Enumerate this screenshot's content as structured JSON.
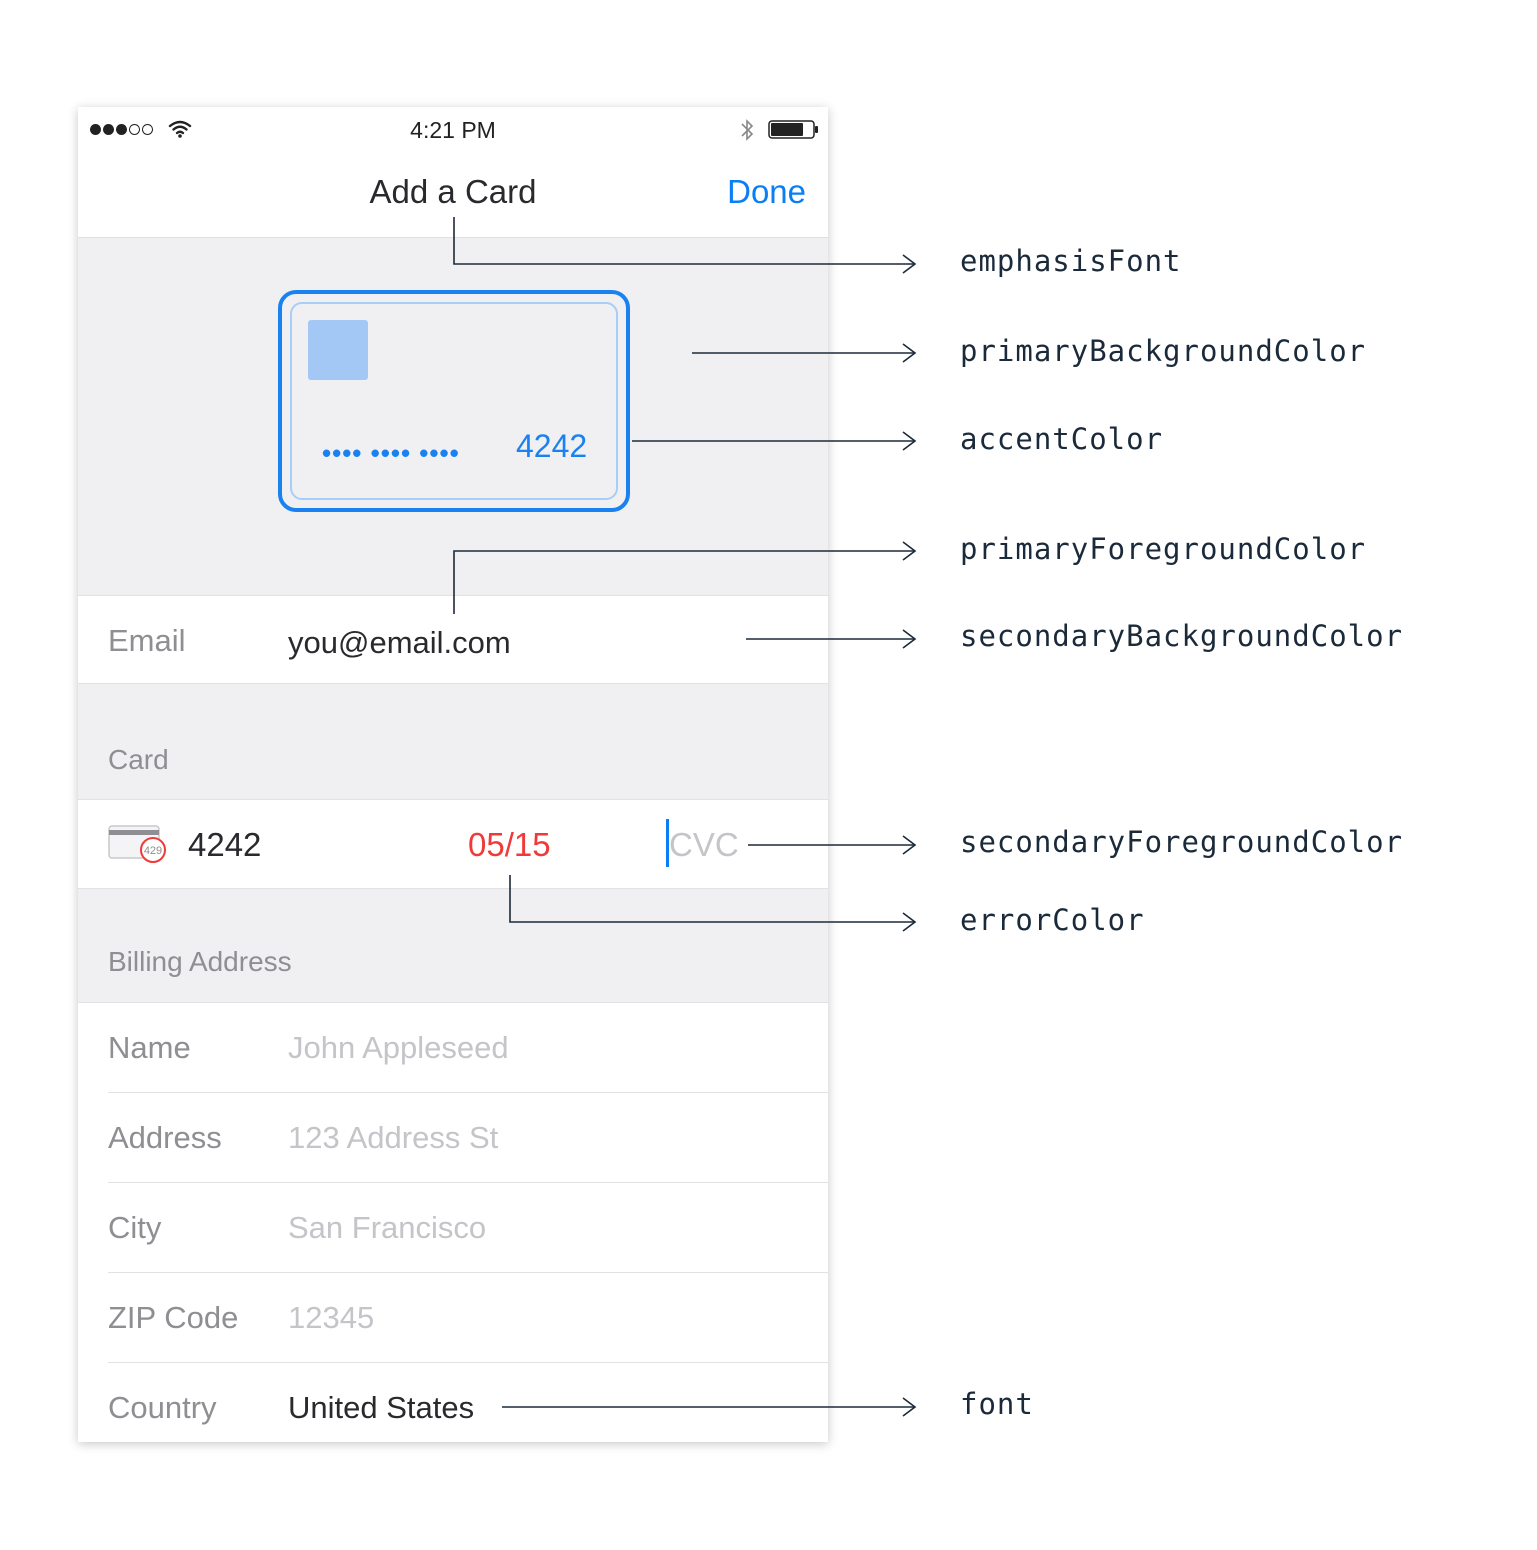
{
  "status_bar": {
    "time": "4:21 PM"
  },
  "nav": {
    "title": "Add a Card",
    "done_label": "Done"
  },
  "card_preview": {
    "masked_digits": "•••• •••• ••••",
    "last4": "4242"
  },
  "email_row": {
    "label": "Email",
    "value": "you@email.com"
  },
  "card_section": {
    "title": "Card",
    "number": "4242",
    "expiry": "05/15",
    "cvc_placeholder": "CVC",
    "brand_icon_text": "429"
  },
  "billing_section": {
    "title": "Billing Address",
    "fields": [
      {
        "label": "Name",
        "placeholder": "John Appleseed"
      },
      {
        "label": "Address",
        "placeholder": "123 Address St"
      },
      {
        "label": "City",
        "placeholder": "San Francisco"
      },
      {
        "label": "ZIP Code",
        "placeholder": "12345"
      },
      {
        "label": "Country",
        "value": "United States"
      }
    ]
  },
  "annotations": {
    "emphasis_font": "emphasisFont",
    "primary_background_color": "primaryBackgroundColor",
    "accent_color": "accentColor",
    "primary_foreground_color": "primaryForegroundColor",
    "secondary_background_color": "secondaryBackgroundColor",
    "secondary_foreground_color": "secondaryForegroundColor",
    "error_color": "errorColor",
    "font": "font"
  },
  "colors": {
    "accent": "#0a7ff5",
    "error": "#f03a3a",
    "primary_background": "#f0f0f3",
    "secondary_background": "#ffffff",
    "primary_foreground": "#2a2a2e",
    "secondary_foreground": "#8e8e93",
    "placeholder": "#c4c4c9"
  },
  "icons": [
    "signal-dots-icon",
    "wifi-icon",
    "bluetooth-icon",
    "battery-icon",
    "card-brand-icon"
  ]
}
